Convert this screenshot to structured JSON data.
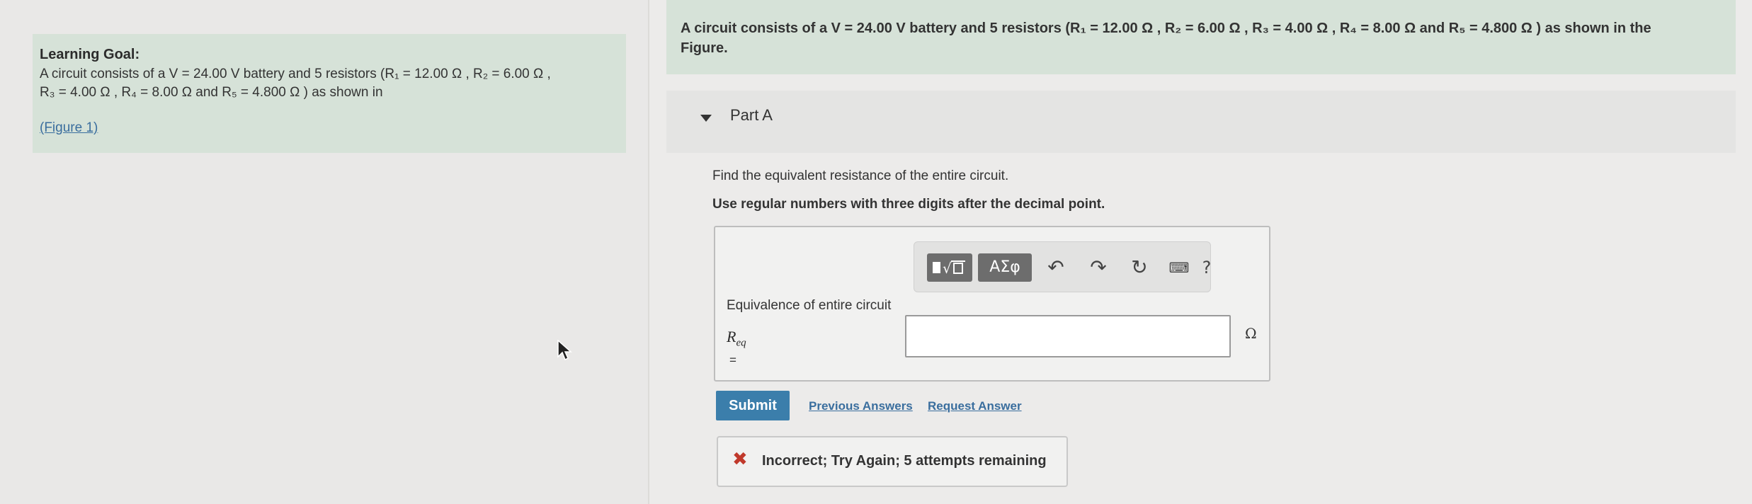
{
  "learning_goal": {
    "title": "Learning Goal:",
    "line1": "A circuit consists of a V = 24.00 V battery and 5 resistors (R₁ = 12.00 Ω , R₂ = 6.00 Ω ,",
    "line2": "R₃ = 4.00 Ω , R₄ = 8.00 Ω and R₅ = 4.800 Ω ) as shown in",
    "figure_link": "(Figure 1)"
  },
  "question": {
    "line1": "A circuit consists of a V = 24.00 V battery and 5 resistors (R₁ = 12.00 Ω , R₂ = 6.00 Ω , R₃ = 4.00 Ω , R₄ = 8.00 Ω and R₅ = 4.800 Ω ) as shown in the",
    "line2": "Figure."
  },
  "part": {
    "label": "Part A"
  },
  "instructions": {
    "prompt": "Find the equivalent resistance of the entire circuit.",
    "format": "Use regular numbers with three digits after the decimal point."
  },
  "toolbar": {
    "templates_icon": "templates-icon",
    "greek_label": "ΑΣφ",
    "undo_icon": "↶",
    "redo_icon": "↷",
    "reset_icon": "↻",
    "keyboard_icon": "⌨",
    "help_label": "?"
  },
  "answer": {
    "label": "Equivalence of entire circuit",
    "variable": "R",
    "subscript": "eq",
    "equals": "=",
    "value": "",
    "unit": "Ω"
  },
  "actions": {
    "submit": "Submit",
    "previous_answers": "Previous Answers",
    "request_answer": "Request Answer"
  },
  "feedback": {
    "icon": "✖",
    "text": "Incorrect; Try Again; 5 attempts remaining"
  },
  "colors": {
    "goal_background": "#d6e2d8",
    "submit_background": "#3b7eab",
    "link": "#3a6e9e",
    "error": "#c0392b"
  }
}
